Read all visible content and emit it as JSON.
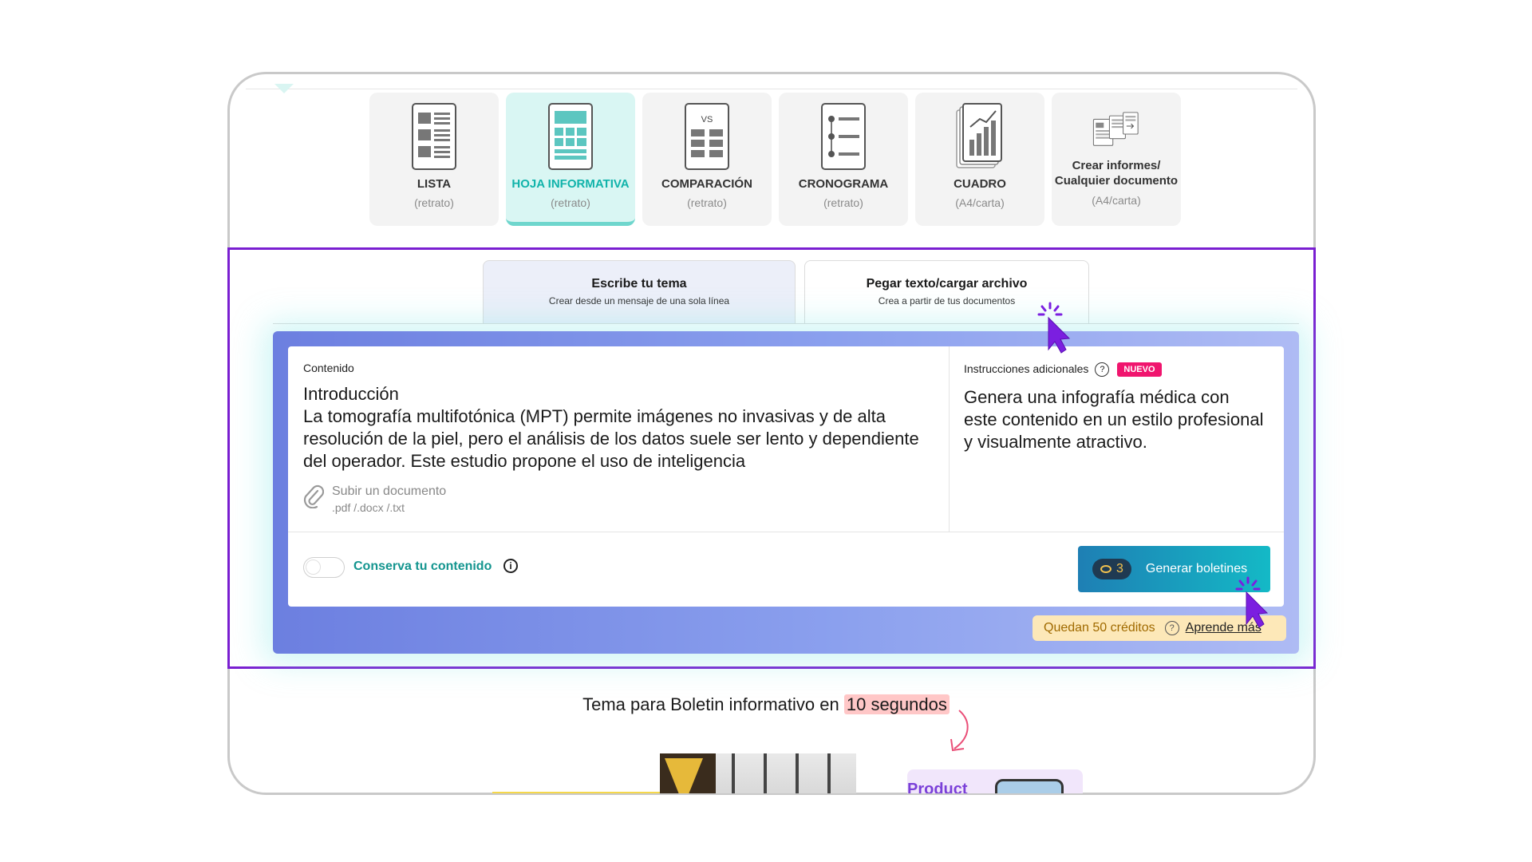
{
  "templates": [
    {
      "name": "LISTA",
      "sub": "(retrato)",
      "icon": "list-layout-icon",
      "active": false
    },
    {
      "name": "HOJA INFORMATIVA",
      "sub": "(retrato)",
      "icon": "newsletter-layout-icon",
      "active": true
    },
    {
      "name": "COMPARACIÓN",
      "sub": "(retrato)",
      "icon": "comparison-layout-icon",
      "active": false
    },
    {
      "name": "CRONOGRAMA",
      "sub": "(retrato)",
      "icon": "timeline-layout-icon",
      "active": false
    },
    {
      "name": "CUADRO",
      "sub": "(A4/carta)",
      "icon": "chart-layout-icon",
      "active": false
    },
    {
      "name": "Crear informes/\nCualquier documento",
      "sub": "(A4/carta)",
      "icon": "documents-layout-icon",
      "active": false
    }
  ],
  "comparison_vs": "VS",
  "tabs": {
    "write": {
      "title": "Escribe tu tema",
      "subtitle": "Crear desde un mensaje de una sola línea"
    },
    "paste": {
      "title": "Pegar texto/cargar archivo",
      "subtitle": "Crea a partir de tus documentos"
    }
  },
  "content": {
    "label": "Contenido",
    "heading": "Introducción",
    "text": "La tomografía multifotónica (MPT) permite imágenes no invasivas y de alta resolución de la piel, pero el análisis de los datos suele ser lento y dependiente del operador. Este estudio propone el uso de inteligencia"
  },
  "upload": {
    "label": "Subir un documento",
    "formats": ".pdf /.docx /.txt"
  },
  "instructions": {
    "label": "Instrucciones adicionales",
    "help": "?",
    "badge": "NUEVO",
    "text": "Genera una infografía médica con este contenido en un estilo profesional y visualmente atractivo."
  },
  "keep_content": {
    "label": "Conserva tu contenido",
    "info": "i",
    "enabled": false
  },
  "generate": {
    "cost": "3",
    "label": "Generar boletines"
  },
  "credits": {
    "text": "Quedan 50 créditos",
    "help": "?",
    "link": "Aprende más"
  },
  "tagline": {
    "prefix": "Tema para Boletin informativo en ",
    "highlight": "10 segundos"
  },
  "preview": {
    "product_text": "Product"
  },
  "colors": {
    "accent_teal": "#10b3aa",
    "selection_purple": "#7a1fd1",
    "cursor_purple": "#7b1fe0",
    "badge_pink": "#f0156e"
  }
}
